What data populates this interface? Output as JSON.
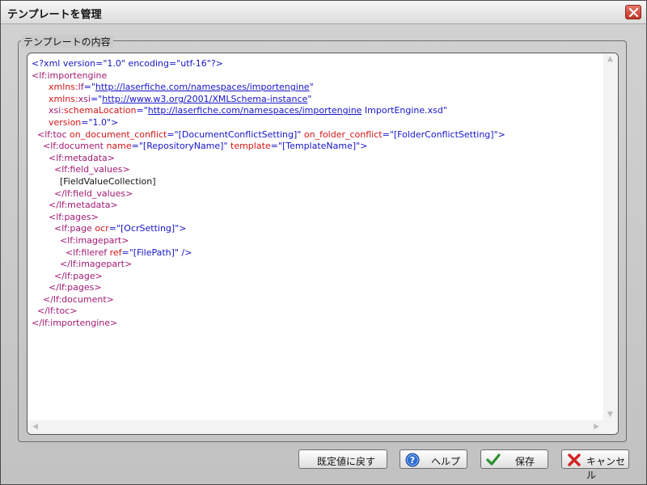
{
  "window": {
    "title": "テンプレートを管理"
  },
  "group": {
    "legend": "テンプレートの内容"
  },
  "xml_lines": [
    [
      {
        "t": "<?xml version=\"1.0\" encoding=\"utf-16\"?>",
        "c": "blue"
      }
    ],
    [
      {
        "t": "<lf:importengine",
        "c": "mag"
      }
    ],
    [
      {
        "t": "      xmlns:",
        "c": "red"
      },
      {
        "t": "lf",
        "c": "mag"
      },
      {
        "t": "=\"",
        "c": "blue"
      },
      {
        "t": "http://laserfiche.com/namespaces/importengine",
        "c": "link"
      },
      {
        "t": "\"",
        "c": "blue"
      }
    ],
    [
      {
        "t": "      xmlns:",
        "c": "red"
      },
      {
        "t": "xsi",
        "c": "mag"
      },
      {
        "t": "=\"",
        "c": "blue"
      },
      {
        "t": "http://www.w3.org/2001/XMLSchema-instance",
        "c": "link"
      },
      {
        "t": "\"",
        "c": "blue"
      }
    ],
    [
      {
        "t": "      xsi:",
        "c": "mag"
      },
      {
        "t": "schemaLocation",
        "c": "red"
      },
      {
        "t": "=\"",
        "c": "blue"
      },
      {
        "t": "http://laserfiche.com/namespaces/importengine",
        "c": "link"
      },
      {
        "t": " ImportEngine.xsd",
        "c": "blue"
      },
      {
        "t": "\"",
        "c": "blue"
      }
    ],
    [
      {
        "t": "      version",
        "c": "red"
      },
      {
        "t": "=\"1.0\">",
        "c": "blue"
      }
    ],
    [
      {
        "t": "  <lf:toc ",
        "c": "mag"
      },
      {
        "t": "on_document_conflict",
        "c": "red"
      },
      {
        "t": "=\"[DocumentConflictSetting]\" ",
        "c": "blue"
      },
      {
        "t": "on_folder_conflict",
        "c": "red"
      },
      {
        "t": "=\"[FolderConflictSetting]\">",
        "c": "blue"
      }
    ],
    [
      {
        "t": "    <lf:document ",
        "c": "mag"
      },
      {
        "t": "name",
        "c": "red"
      },
      {
        "t": "=\"[RepositoryName]\" ",
        "c": "blue"
      },
      {
        "t": "template",
        "c": "red"
      },
      {
        "t": "=\"[TemplateName]\">",
        "c": "blue"
      }
    ],
    [
      {
        "t": "      <lf:metadata>",
        "c": "mag"
      }
    ],
    [
      {
        "t": "        <lf:field_values>",
        "c": "mag"
      }
    ],
    [
      {
        "t": "          [FieldValueCollection]",
        "c": "blk"
      }
    ],
    [
      {
        "t": "        </lf:field_values>",
        "c": "mag"
      }
    ],
    [
      {
        "t": "      </lf:metadata>",
        "c": "mag"
      }
    ],
    [
      {
        "t": "      <lf:pages>",
        "c": "mag"
      }
    ],
    [
      {
        "t": "        <lf:page ",
        "c": "mag"
      },
      {
        "t": "ocr",
        "c": "red"
      },
      {
        "t": "=\"[OcrSetting]\">",
        "c": "blue"
      }
    ],
    [
      {
        "t": "          <lf:imagepart>",
        "c": "mag"
      }
    ],
    [
      {
        "t": "            <lf:fileref ",
        "c": "mag"
      },
      {
        "t": "ref",
        "c": "red"
      },
      {
        "t": "=\"[FilePath]\" />",
        "c": "blue"
      }
    ],
    [
      {
        "t": "          </lf:imagepart>",
        "c": "mag"
      }
    ],
    [
      {
        "t": "        </lf:page>",
        "c": "mag"
      }
    ],
    [
      {
        "t": "      </lf:pages>",
        "c": "mag"
      }
    ],
    [
      {
        "t": "    </lf:document>",
        "c": "mag"
      }
    ],
    [
      {
        "t": "  </lf:toc>",
        "c": "mag"
      }
    ],
    [
      {
        "t": "</lf:importengine>",
        "c": "mag"
      }
    ]
  ],
  "buttons": {
    "reset_label": "既定値に戻す",
    "help_label": "ヘルプ",
    "save_label": "保存",
    "cancel_label": "キャンセル"
  },
  "icons": {
    "close": "close-icon",
    "help": "help-icon",
    "save": "checkmark-icon",
    "cancel": "x-icon"
  },
  "colors": {
    "tag": "#a01a74",
    "attribute": "#d01515",
    "value": "#1515c8",
    "close_button": "#c23324"
  }
}
